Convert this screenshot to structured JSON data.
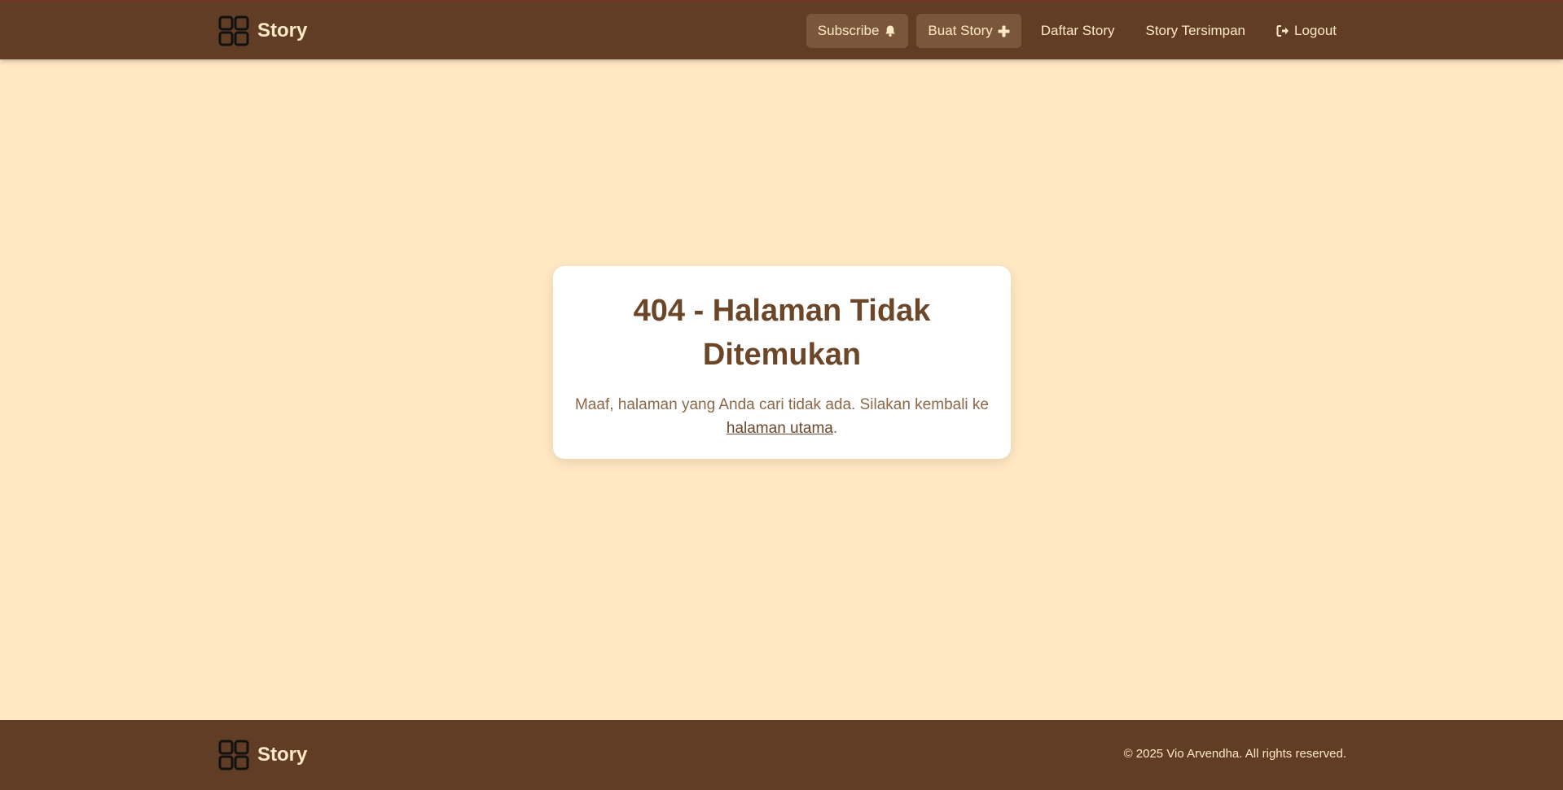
{
  "header": {
    "brand": "Story",
    "nav": [
      {
        "label": "Subscribe",
        "icon": "bell-icon"
      },
      {
        "label": "Buat Story",
        "icon": "plus-icon"
      },
      {
        "label": "Daftar Story"
      },
      {
        "label": "Story Tersimpan"
      },
      {
        "label": "Logout",
        "icon": "logout-icon"
      }
    ]
  },
  "error": {
    "title": "404 - Halaman Tidak Ditemukan",
    "message_before": "Maaf, halaman yang Anda cari tidak ada. Silakan kembali ke",
    "link": "halaman utama",
    "message_after": "."
  },
  "footer": {
    "brand": "Story",
    "copyright": "© 2025 Vio Arvendha. All rights reserved."
  },
  "colors": {
    "header_bg": "#603d24",
    "page_bg": "#ffe9c5",
    "accent_text": "#ffe9c5",
    "title": "#6b4628"
  }
}
